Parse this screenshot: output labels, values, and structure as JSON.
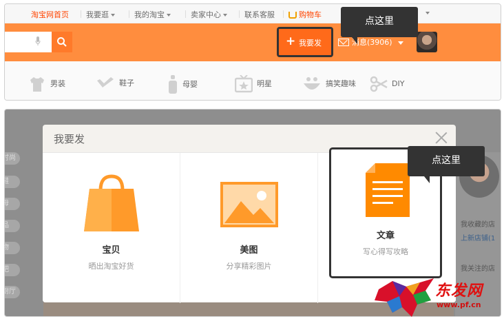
{
  "topbar": {
    "home": "淘宝网首页",
    "browse": "我要逛",
    "my_taobao": "我的淘宝",
    "seller_center": "卖家中心",
    "support": "联系客服",
    "cart": "购物车"
  },
  "header": {
    "post_button": "我要发",
    "messages": "消息(3906)",
    "tooltip": "点这里"
  },
  "categories": [
    {
      "label": "男装",
      "icon": "shirt-icon"
    },
    {
      "label": "鞋子",
      "icon": "shoe-icon"
    },
    {
      "label": "母婴",
      "icon": "bottle-icon"
    },
    {
      "label": "明星",
      "icon": "tv-icon"
    },
    {
      "label": "搞笑趣味",
      "icon": "smile-icon"
    },
    {
      "label": "DIY",
      "icon": "scissors-icon"
    }
  ],
  "background": {
    "side_tags": [
      "时尚",
      "鞋",
      "母",
      "品",
      "物",
      "吧",
      "厨厅",
      "美"
    ],
    "right_texts": [
      "我收藏的店",
      "上新店铺(1",
      "我关注的店"
    ]
  },
  "modal": {
    "title": "我要发",
    "options": [
      {
        "title": "宝贝",
        "desc": "晒出淘宝好货",
        "icon": "shopping-bag-icon"
      },
      {
        "title": "美图",
        "desc": "分享精彩图片",
        "icon": "image-icon"
      },
      {
        "title": "文章",
        "desc": "写心得写攻略",
        "icon": "document-icon"
      }
    ],
    "tooltip": "点这里"
  },
  "watermark": {
    "text": "东发网",
    "url": "www.pf.cn"
  },
  "colors": {
    "accent": "#ff8d3e",
    "button": "#ff6a1a",
    "tooltip": "#333333",
    "bag": "#ff9a2a",
    "doc": "#ff8a00"
  }
}
